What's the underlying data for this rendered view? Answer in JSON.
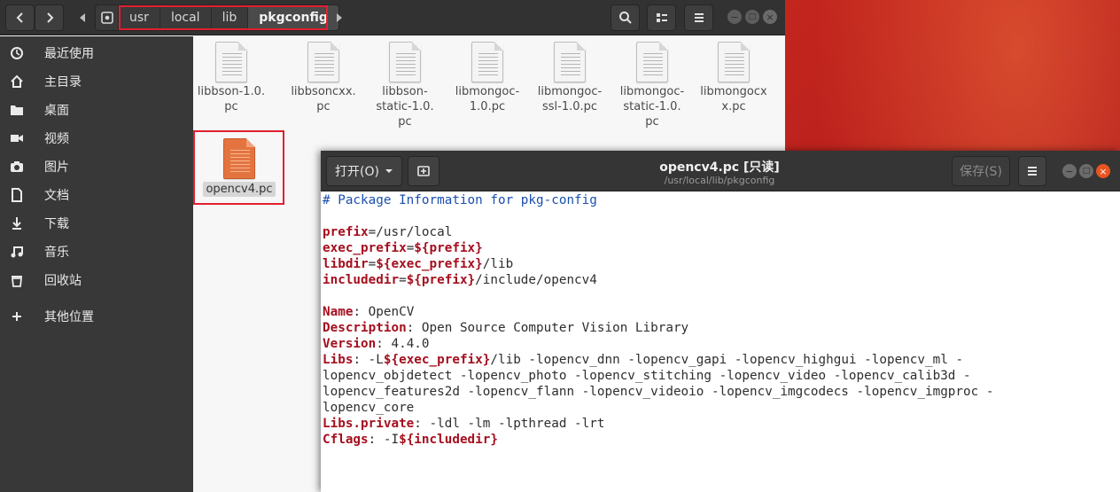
{
  "files_window": {
    "breadcrumbs": [
      "usr",
      "local",
      "lib",
      "pkgconfig"
    ],
    "sidebar": [
      {
        "label": "最近使用",
        "icon": "clock-icon"
      },
      {
        "label": "主目录",
        "icon": "home-icon"
      },
      {
        "label": "桌面",
        "icon": "folder-icon"
      },
      {
        "label": "视频",
        "icon": "video-icon"
      },
      {
        "label": "图片",
        "icon": "camera-icon"
      },
      {
        "label": "文档",
        "icon": "document-icon"
      },
      {
        "label": "下载",
        "icon": "download-icon"
      },
      {
        "label": "音乐",
        "icon": "music-icon"
      },
      {
        "label": "回收站",
        "icon": "trash-icon"
      },
      {
        "label": "其他位置",
        "icon": "plus-icon"
      }
    ],
    "files": [
      {
        "name_lines": [
          "libbson-1.0.",
          "pc"
        ]
      },
      {
        "name_lines": [
          "libbsoncxx.",
          "pc"
        ]
      },
      {
        "name_lines": [
          "libbson-",
          "static-1.0.",
          "pc"
        ]
      },
      {
        "name_lines": [
          "libmongoc-",
          "1.0.pc"
        ]
      },
      {
        "name_lines": [
          "libmongoc-",
          "ssl-1.0.pc"
        ]
      },
      {
        "name_lines": [
          "libmongoc-",
          "static-1.0.",
          "pc"
        ]
      },
      {
        "name_lines": [
          "libmongocx",
          "x.pc"
        ]
      },
      {
        "name_lines": [
          "opencv4.pc"
        ],
        "selected": true,
        "color": "#e4743f"
      }
    ]
  },
  "editor_window": {
    "open_button": "打开(O)",
    "title": "opencv4.pc [只读]",
    "subtitle": "/usr/local/lib/pkgconfig",
    "save_button": "保存(S)",
    "lines": [
      [
        {
          "t": "# Package Information for pkg-config",
          "c": "cm"
        }
      ],
      [],
      [
        {
          "t": "prefix",
          "c": "kw"
        },
        {
          "t": "=/usr/local",
          "c": ""
        }
      ],
      [
        {
          "t": "exec_prefix",
          "c": "kw"
        },
        {
          "t": "=",
          "c": ""
        },
        {
          "t": "${prefix}",
          "c": "kw"
        }
      ],
      [
        {
          "t": "libdir",
          "c": "kw"
        },
        {
          "t": "=",
          "c": ""
        },
        {
          "t": "${exec_prefix}",
          "c": "kw"
        },
        {
          "t": "/lib",
          "c": ""
        }
      ],
      [
        {
          "t": "includedir",
          "c": "kw"
        },
        {
          "t": "=",
          "c": ""
        },
        {
          "t": "${prefix}",
          "c": "kw"
        },
        {
          "t": "/include/opencv4",
          "c": ""
        }
      ],
      [],
      [
        {
          "t": "Name",
          "c": "kw"
        },
        {
          "t": ": OpenCV",
          "c": ""
        }
      ],
      [
        {
          "t": "Description",
          "c": "kw"
        },
        {
          "t": ": Open Source Computer Vision Library",
          "c": ""
        }
      ],
      [
        {
          "t": "Version",
          "c": "kw"
        },
        {
          "t": ": 4.4.0",
          "c": ""
        }
      ],
      [
        {
          "t": "Libs",
          "c": "kw"
        },
        {
          "t": ": -L",
          "c": ""
        },
        {
          "t": "${exec_prefix}",
          "c": "kw"
        },
        {
          "t": "/lib -lopencv_dnn -lopencv_gapi -lopencv_highgui -lopencv_ml -",
          "c": ""
        }
      ],
      [
        {
          "t": "lopencv_objdetect -lopencv_photo -lopencv_stitching -lopencv_video -lopencv_calib3d -",
          "c": ""
        }
      ],
      [
        {
          "t": "lopencv_features2d -lopencv_flann -lopencv_videoio -lopencv_imgcodecs -lopencv_imgproc -",
          "c": ""
        }
      ],
      [
        {
          "t": "lopencv_core",
          "c": ""
        }
      ],
      [
        {
          "t": "Libs.private",
          "c": "kw"
        },
        {
          "t": ": -ldl -lm -lpthread -lrt",
          "c": ""
        }
      ],
      [
        {
          "t": "Cflags",
          "c": "kw"
        },
        {
          "t": ": -I",
          "c": ""
        },
        {
          "t": "${includedir}",
          "c": "kw"
        }
      ]
    ]
  }
}
